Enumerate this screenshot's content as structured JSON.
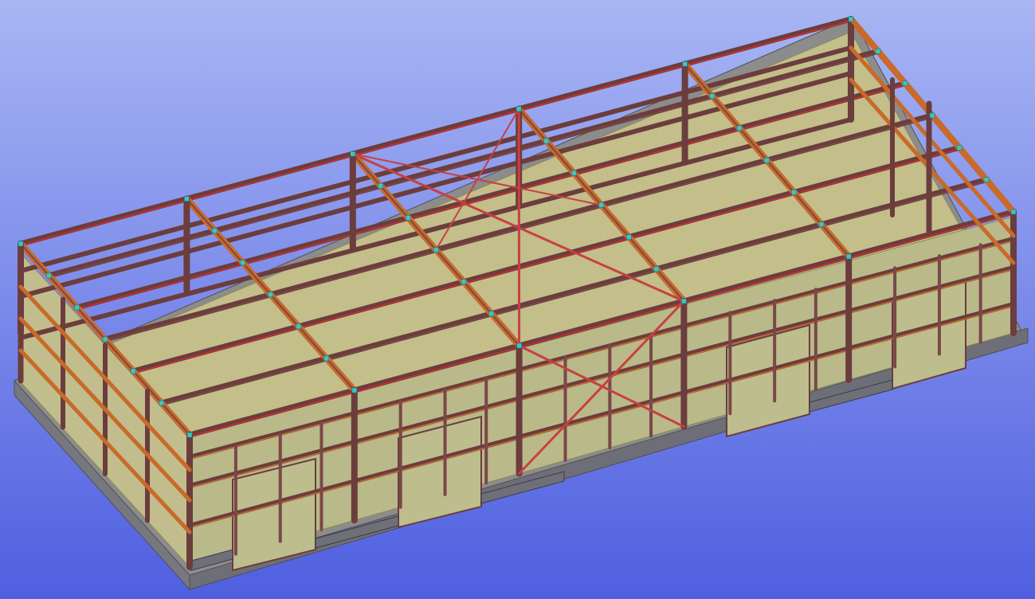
{
  "view": {
    "background_top": "#a8b6f4",
    "background_bottom": "#4f5fe0",
    "steel_color": "#6b3d3d",
    "highlight_color": "#d42a2a",
    "brace_color": "#c86a2a",
    "wall_color": "#b9b98a",
    "floor_color": "#c3be8a",
    "slab_color": "#8c8c8c",
    "connector_color": "#39c6c6"
  },
  "model": {
    "structure": "steel-frame-building",
    "bays_long_side": 5,
    "roof_girts": 6,
    "wall_girts": 3,
    "doors_front": 4
  }
}
